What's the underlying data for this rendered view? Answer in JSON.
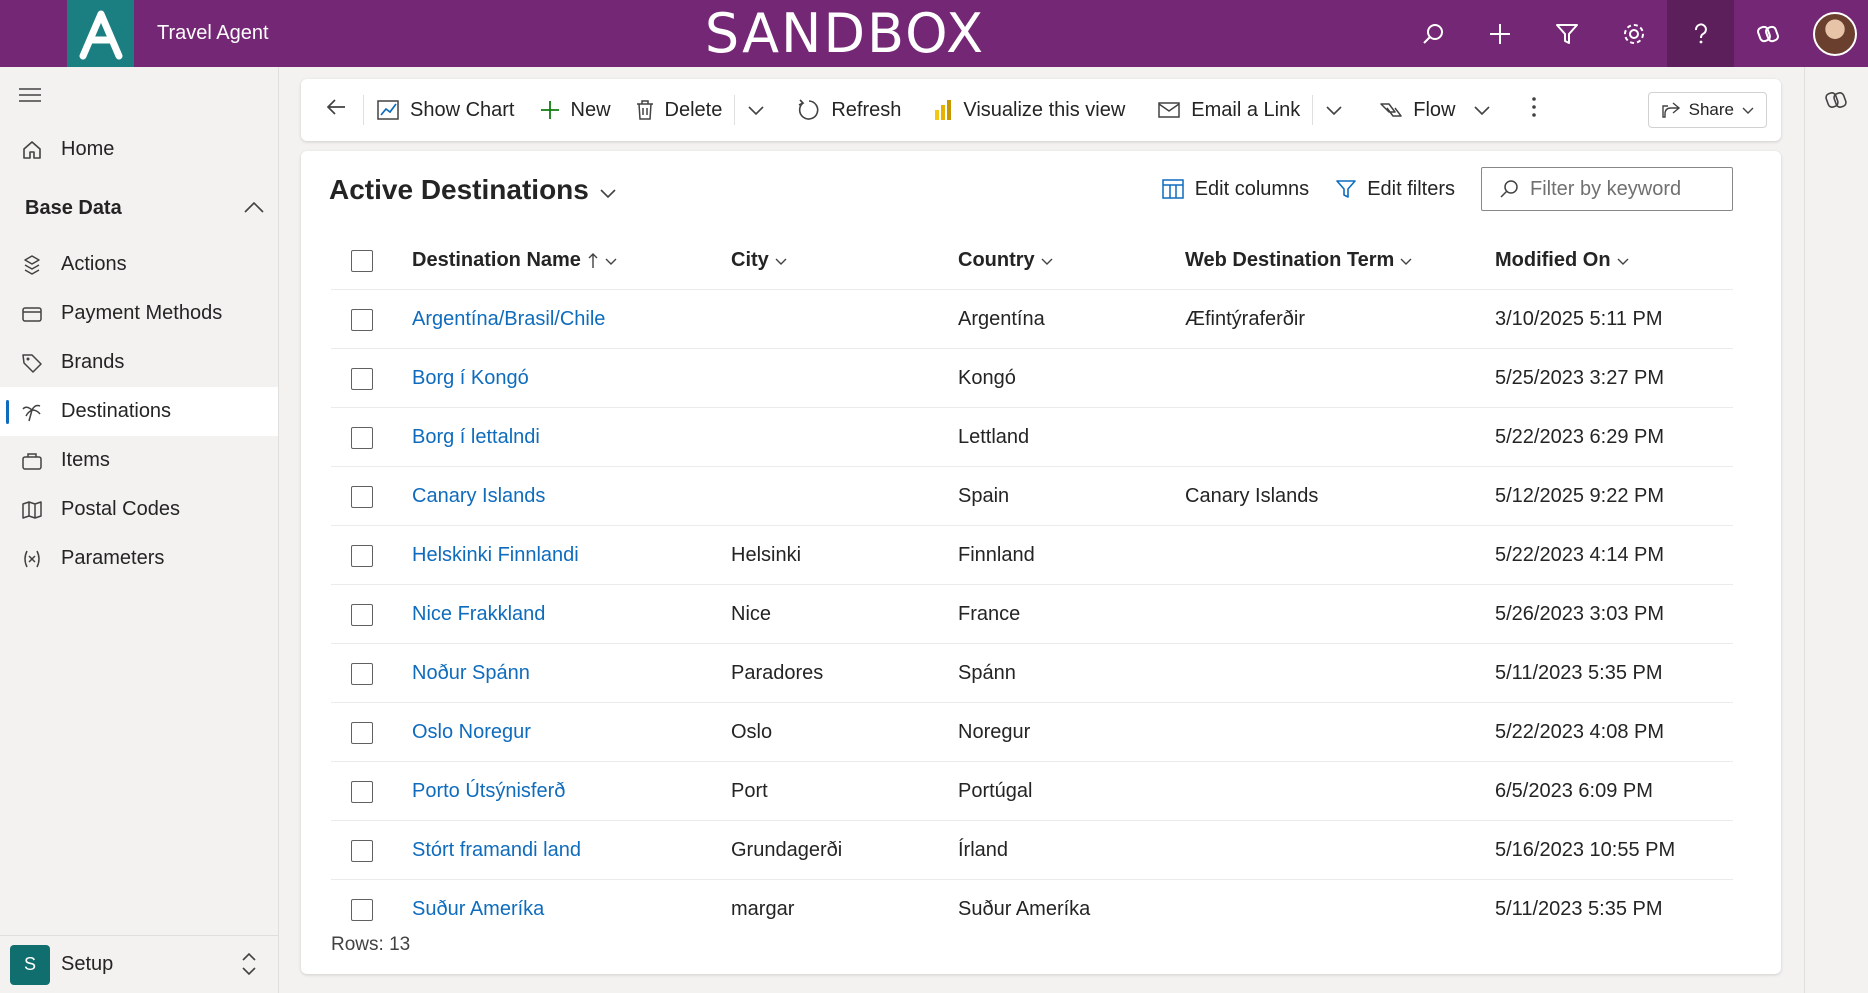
{
  "header": {
    "app_name": "Travel Agent",
    "environment": "SANDBOX",
    "icons": [
      "search-icon",
      "plus-icon",
      "filter-icon",
      "gear-icon",
      "help-icon",
      "copilot-icon",
      "avatar"
    ],
    "colors": {
      "bar": "#742774",
      "logo_tile": "#1b7f82"
    }
  },
  "sidebar": {
    "home_label": "Home",
    "group_label": "Base Data",
    "items": [
      {
        "label": "Actions",
        "icon": "actions-icon"
      },
      {
        "label": "Payment Methods",
        "icon": "card-icon"
      },
      {
        "label": "Brands",
        "icon": "tag-icon"
      },
      {
        "label": "Destinations",
        "icon": "palm-tree-icon",
        "selected": true
      },
      {
        "label": "Items",
        "icon": "items-icon"
      },
      {
        "label": "Postal Codes",
        "icon": "map-icon"
      },
      {
        "label": "Parameters",
        "icon": "variable-icon"
      }
    ],
    "area": {
      "badge": "S",
      "label": "Setup"
    }
  },
  "commandbar": {
    "show_chart": "Show Chart",
    "new": "New",
    "delete": "Delete",
    "refresh": "Refresh",
    "visualize": "Visualize this view",
    "email_link": "Email a Link",
    "flow": "Flow",
    "share": "Share"
  },
  "view": {
    "title": "Active Destinations",
    "edit_columns": "Edit columns",
    "edit_filters": "Edit filters",
    "filter_placeholder": "Filter by keyword",
    "columns": [
      "Destination Name",
      "City",
      "Country",
      "Web Destination Term",
      "Modified On"
    ],
    "rows": [
      {
        "name": "Argentína/Brasil/Chile",
        "city": "",
        "country": "Argentína",
        "term": "Æfintýraferðir",
        "modified": "3/10/2025 5:11 PM"
      },
      {
        "name": "Borg í Kongó",
        "city": "",
        "country": "Kongó",
        "term": "",
        "modified": "5/25/2023 3:27 PM"
      },
      {
        "name": "Borg í lettalndi",
        "city": "",
        "country": "Lettland",
        "term": "",
        "modified": "5/22/2023 6:29 PM"
      },
      {
        "name": "Canary Islands",
        "city": "",
        "country": "Spain",
        "term": "Canary Islands",
        "modified": "5/12/2025 9:22 PM"
      },
      {
        "name": "Helskinki Finnlandi",
        "city": "Helsinki",
        "country": "Finnland",
        "term": "",
        "modified": "5/22/2023 4:14 PM"
      },
      {
        "name": "Nice Frakkland",
        "city": "Nice",
        "country": "France",
        "term": "",
        "modified": "5/26/2023 3:03 PM"
      },
      {
        "name": "Noður Spánn",
        "city": "Paradores",
        "country": "Spánn",
        "term": "",
        "modified": "5/11/2023 5:35 PM"
      },
      {
        "name": "Oslo Noregur",
        "city": "Oslo",
        "country": "Noregur",
        "term": "",
        "modified": "5/22/2023 4:08 PM"
      },
      {
        "name": "Porto Útsýnisferð",
        "city": "Port",
        "country": "Portúgal",
        "term": "",
        "modified": "6/5/2023 6:09 PM"
      },
      {
        "name": "Stórt framandi land",
        "city": "Grundagerði",
        "country": "Írland",
        "term": "",
        "modified": "5/16/2023 10:55 PM"
      },
      {
        "name": "Suður Ameríka",
        "city": "margar",
        "country": "Suður Ameríka",
        "term": "",
        "modified": "5/11/2023 5:35 PM"
      }
    ],
    "rows_count": "Rows: 13"
  }
}
